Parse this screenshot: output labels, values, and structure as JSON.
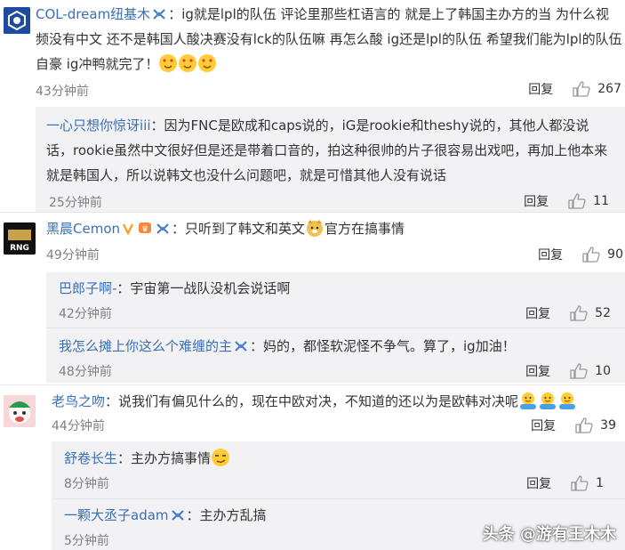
{
  "reply_label": "回复",
  "comments": [
    {
      "user": "COL-dream纽基木",
      "text": "：ig就是lpl的队伍 评论里那些杠语言的 就是上了韩国主办方的当 为什么视频没有中文 还不是韩国人酸决赛没有lck的队伍嘛 再怎么酸 ig还是lpl的队伍 希望我们能为lpl的队伍自豪 ig冲鸭就完了！",
      "time": "43分钟前",
      "likes": "267"
    },
    {
      "user": "一心只想你惊讶iii",
      "text": "：因为FNC是欧成和caps说的，iG是rookie和theshy说的，其他人都没说话，rookie虽然中文很好但是还是带着口音的，拍这种很帅的片子很容易出戏吧，再加上他本来就是韩国人，所以说韩文也没什么问题吧，就是可惜其他人没有说话",
      "time": "25分钟前",
      "likes": "11"
    },
    {
      "user": "黑晨Cemon",
      "text": "：只听到了韩文和英文",
      "text2": "官方在搞事情",
      "time": "49分钟前",
      "likes": "90"
    },
    {
      "user": "巴郎子啊-",
      "text": "：宇宙第一战队没机会说话啊",
      "time": "42分钟前",
      "likes": "52"
    },
    {
      "user": "我怎么摊上你这么个难缠的主",
      "text": "：妈的，都怪软泥怪不争气。算了，ig加油！",
      "time": "48分钟前",
      "likes": "10"
    },
    {
      "user": "老鸟之吻",
      "text": "：说我们有偏见什么的，现在中欧对决，不知道的还以为是欧韩对决呢",
      "time": "44分钟前",
      "likes": "39"
    },
    {
      "user": "舒卷长生",
      "text": "：主办方搞事情",
      "time": "8分钟前",
      "likes": "1"
    },
    {
      "user": "一颗大丞子adam",
      "text": "：主办方乱搞",
      "time": "5分钟前",
      "likes": ""
    }
  ],
  "watermark": "头条 @游有王木木",
  "avatar_texts": {
    "rng": "RNG"
  }
}
